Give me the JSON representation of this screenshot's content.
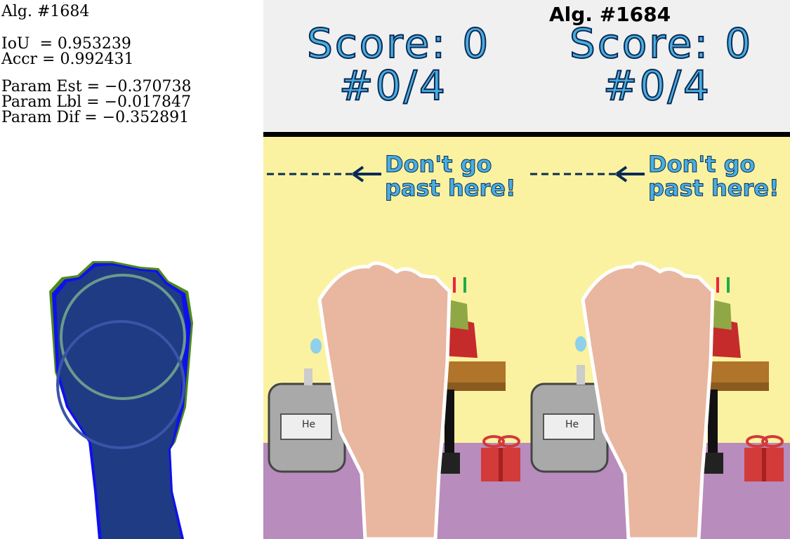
{
  "left_panel": {
    "alg": "Alg. #1684",
    "iou": "IoU  = 0.953239",
    "accr": "Accr = 0.992431",
    "param_est": "Param Est = −0.370738",
    "param_lbl": "Param Lbl = −0.017847",
    "param_dif": "Param Dif = −0.352891"
  },
  "hud": {
    "alg": "Alg. #1684",
    "panels": [
      {
        "score": "Score: 0",
        "count": "#0/4"
      },
      {
        "score": "Score: 0",
        "count": "#0/4"
      }
    ]
  },
  "scene": {
    "warning_line1": "Don't go",
    "warning_line2": "past here!",
    "tank_label": "He"
  },
  "colors": {
    "wall": "#faf2a0",
    "floor": "#b88cbc",
    "mask_blue": "#1f3b84",
    "score_blue": "#4aaee0",
    "gift_red": "#d33a3a"
  },
  "icons": [
    "hand-mask-icon",
    "gas-tank-icon",
    "cake-icon",
    "gift-icon",
    "left-arrow-icon"
  ]
}
